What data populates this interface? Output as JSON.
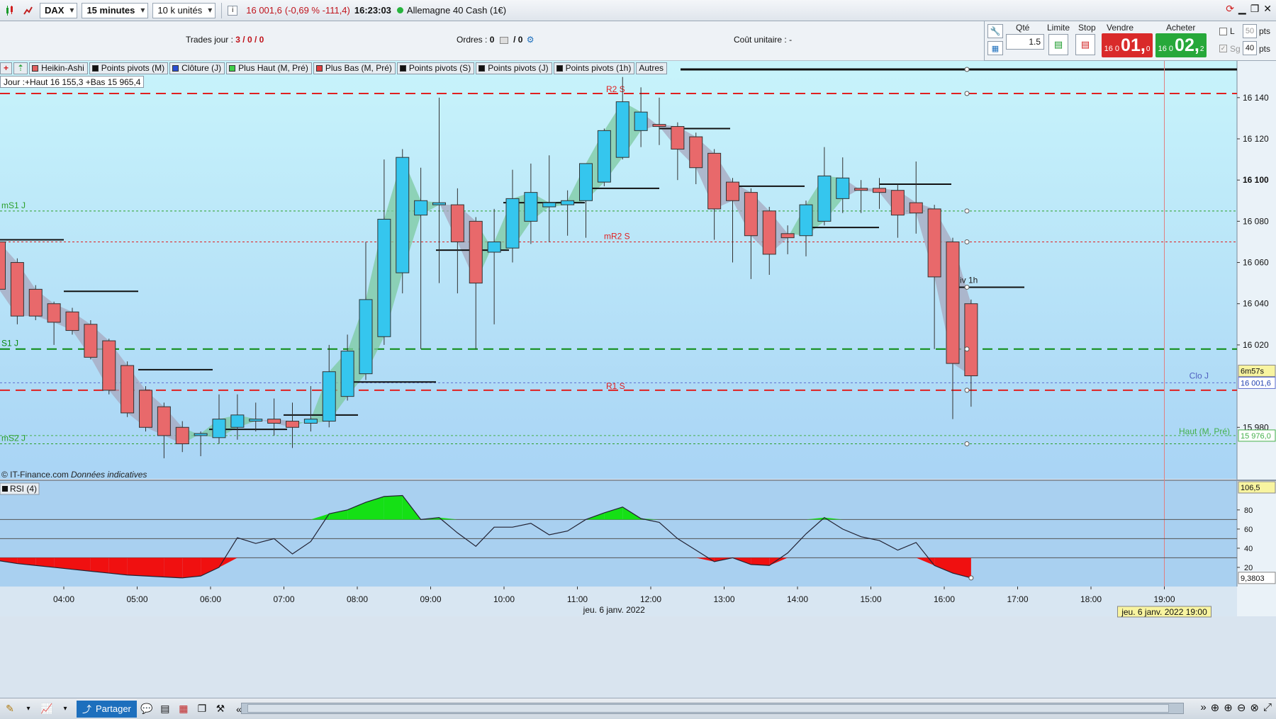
{
  "toolbar": {
    "instrument": "DAX",
    "timeframe": "15 minutes",
    "units": "10 k unités",
    "info_icon": "i",
    "price": "16 001,6",
    "change": "(-0,69 % -111,4)",
    "time": "16:23:03",
    "market": "Allemagne 40 Cash (1€)"
  },
  "infobar": {
    "trades_label": "Trades jour :",
    "trades_value": "3 / 0 / 0",
    "orders_label": "Ordres :",
    "orders_value_a": "0",
    "orders_value_b": "/ 0",
    "cost_label": "Coût unitaire :",
    "cost_value": "-"
  },
  "order_panel": {
    "qty_label": "Qté",
    "qty_value": "1.5",
    "limit_label": "Limite",
    "stop_label": "Stop",
    "sell_label": "Vendre",
    "buy_label": "Acheter",
    "sell_prefix": "16 0",
    "sell_big": "01,",
    "sell_sup": "0",
    "buy_prefix": "16 0",
    "buy_big": "02,",
    "buy_sup": "2",
    "l_label": "L",
    "sg_label": "Sg",
    "pts1_value": "50",
    "pts2_value": "40",
    "pts_label": "pts",
    "sell_color": "#d92a2a",
    "buy_color": "#27a83a"
  },
  "indicator_tags": [
    {
      "label": "Heikin-Ashi",
      "color": "#e06060"
    },
    {
      "label": "Points pivots (M)",
      "color": "#111111"
    },
    {
      "label": "Clôture (J)",
      "color": "#2a4fd1"
    },
    {
      "label": "Plus Haut (M, Pré)",
      "color": "#3fcf4a"
    },
    {
      "label": "Plus Bas (M, Pré)",
      "color": "#e04040"
    },
    {
      "label": "Points pivots (S)",
      "color": "#111111"
    },
    {
      "label": "Points pivots (J)",
      "color": "#111111"
    },
    {
      "label": "Points pivots (1h)",
      "color": "#111111"
    },
    {
      "label": "Autres",
      "color": ""
    }
  ],
  "day_info": "Jour :+Haut 16 155,3 +Bas 15 965,4",
  "copyright": "© IT-Finance.com",
  "disclaimer": "Données indicatives",
  "rsi_label": "RSI (4)",
  "date_label": "jeu. 6 janv. 2022",
  "cursor_date": "jeu. 6 janv. 2022 19:00",
  "level_labels": {
    "r2s": "R2 S",
    "ms1j": "mS1 J",
    "mr2s": "mR2 S",
    "s1j": "S1 J",
    "r1s": "R1 S",
    "ms2j": "mS2 J",
    "piv1h": "Piv 1h",
    "cloj": "Clo J",
    "hautm": "Haut (M, Pré)",
    "countdown": "6m57s",
    "last_price": "16 001,6",
    "haut_price": "15 976,0",
    "rsi_top": "106,5",
    "rsi_value": "9,3803"
  },
  "bottom": {
    "share_label": "Partager"
  },
  "chart_data": {
    "type": "candlestick",
    "instrument": "DAX",
    "timeframe": "15 minutes",
    "y_ticks": [
      "16 140",
      "16 120",
      "16 100",
      "16 080",
      "16 060",
      "16 040",
      "16 020",
      "15 980"
    ],
    "y_tick_values": [
      16140,
      16120,
      16100,
      16080,
      16060,
      16040,
      16020,
      15980
    ],
    "ylim": [
      15955,
      16153
    ],
    "x_ticks": [
      "04:00",
      "05:00",
      "06:00",
      "07:00",
      "08:00",
      "09:00",
      "10:00",
      "11:00",
      "12:00",
      "13:00",
      "14:00",
      "15:00",
      "16:00",
      "17:00",
      "18:00",
      "19:00"
    ],
    "x_tick_hours": [
      4,
      5,
      6,
      7,
      8,
      9,
      10,
      11,
      12,
      13,
      14,
      15,
      16,
      17,
      18,
      19
    ],
    "candles": [
      {
        "t": "03:00",
        "o": 16070,
        "h": 16072,
        "l": 16040,
        "c": 16047
      },
      {
        "t": "03:15",
        "o": 16060,
        "h": 16062,
        "l": 16030,
        "c": 16034
      },
      {
        "t": "03:30",
        "o": 16047,
        "h": 16049,
        "l": 16032,
        "c": 16034
      },
      {
        "t": "03:45",
        "o": 16040,
        "h": 16041,
        "l": 16020,
        "c": 16031
      },
      {
        "t": "04:00",
        "o": 16036,
        "h": 16038,
        "l": 16025,
        "c": 16027
      },
      {
        "t": "04:15",
        "o": 16030,
        "h": 16032,
        "l": 16013,
        "c": 16014
      },
      {
        "t": "04:30",
        "o": 16022,
        "h": 16023,
        "l": 15996,
        "c": 15998
      },
      {
        "t": "04:45",
        "o": 16010,
        "h": 16012,
        "l": 15985,
        "c": 15987
      },
      {
        "t": "05:00",
        "o": 15998,
        "h": 16000,
        "l": 15978,
        "c": 15980
      },
      {
        "t": "05:15",
        "o": 15990,
        "h": 15992,
        "l": 15965,
        "c": 15976
      },
      {
        "t": "05:30",
        "o": 15980,
        "h": 15983,
        "l": 15968,
        "c": 15972
      },
      {
        "t": "05:45",
        "o": 15976,
        "h": 15978,
        "l": 15966,
        "c": 15977
      },
      {
        "t": "06:00",
        "o": 15975,
        "h": 15996,
        "l": 15972,
        "c": 15984
      },
      {
        "t": "06:15",
        "o": 15980,
        "h": 15996,
        "l": 15974,
        "c": 15986
      },
      {
        "t": "06:30",
        "o": 15983,
        "h": 15992,
        "l": 15978,
        "c": 15984
      },
      {
        "t": "06:45",
        "o": 15984,
        "h": 15994,
        "l": 15976,
        "c": 15982
      },
      {
        "t": "07:00",
        "o": 15983,
        "h": 15992,
        "l": 15970,
        "c": 15980
      },
      {
        "t": "07:15",
        "o": 15982,
        "h": 16000,
        "l": 15978,
        "c": 15984
      },
      {
        "t": "07:30",
        "o": 15983,
        "h": 16020,
        "l": 15980,
        "c": 16007
      },
      {
        "t": "07:45",
        "o": 15995,
        "h": 16025,
        "l": 15993,
        "c": 16017
      },
      {
        "t": "08:00",
        "o": 16006,
        "h": 16070,
        "l": 16003,
        "c": 16042
      },
      {
        "t": "08:15",
        "o": 16024,
        "h": 16110,
        "l": 16020,
        "c": 16081
      },
      {
        "t": "08:30",
        "o": 16055,
        "h": 16115,
        "l": 16045,
        "c": 16111
      },
      {
        "t": "08:45",
        "o": 16083,
        "h": 16106,
        "l": 16018,
        "c": 16090
      },
      {
        "t": "09:00",
        "o": 16088,
        "h": 16140,
        "l": 16050,
        "c": 16089
      },
      {
        "t": "09:15",
        "o": 16088,
        "h": 16096,
        "l": 16045,
        "c": 16070
      },
      {
        "t": "09:30",
        "o": 16080,
        "h": 16082,
        "l": 16018,
        "c": 16050
      },
      {
        "t": "09:45",
        "o": 16065,
        "h": 16086,
        "l": 16030,
        "c": 16070
      },
      {
        "t": "10:00",
        "o": 16067,
        "h": 16105,
        "l": 16060,
        "c": 16091
      },
      {
        "t": "10:15",
        "o": 16080,
        "h": 16108,
        "l": 16069,
        "c": 16094
      },
      {
        "t": "10:30",
        "o": 16087,
        "h": 16112,
        "l": 16070,
        "c": 16089
      },
      {
        "t": "10:45",
        "o": 16088,
        "h": 16095,
        "l": 16073,
        "c": 16090
      },
      {
        "t": "11:00",
        "o": 16090,
        "h": 16107,
        "l": 16072,
        "c": 16108
      },
      {
        "t": "11:15",
        "o": 16099,
        "h": 16125,
        "l": 16097,
        "c": 16124
      },
      {
        "t": "11:30",
        "o": 16111,
        "h": 16150,
        "l": 16110,
        "c": 16138
      },
      {
        "t": "11:45",
        "o": 16124,
        "h": 16145,
        "l": 16116,
        "c": 16133
      },
      {
        "t": "12:00",
        "o": 16127,
        "h": 16140,
        "l": 16117,
        "c": 16126
      },
      {
        "t": "12:15",
        "o": 16126,
        "h": 16128,
        "l": 16100,
        "c": 16115
      },
      {
        "t": "12:30",
        "o": 16121,
        "h": 16123,
        "l": 16098,
        "c": 16106
      },
      {
        "t": "12:45",
        "o": 16113,
        "h": 16115,
        "l": 16071,
        "c": 16086
      },
      {
        "t": "13:00",
        "o": 16099,
        "h": 16101,
        "l": 16060,
        "c": 16090
      },
      {
        "t": "13:15",
        "o": 16094,
        "h": 16096,
        "l": 16052,
        "c": 16073
      },
      {
        "t": "13:30",
        "o": 16085,
        "h": 16087,
        "l": 16054,
        "c": 16064
      },
      {
        "t": "13:45",
        "o": 16074,
        "h": 16078,
        "l": 16064,
        "c": 16072
      },
      {
        "t": "14:00",
        "o": 16073,
        "h": 16090,
        "l": 16063,
        "c": 16088
      },
      {
        "t": "14:15",
        "o": 16080,
        "h": 16116,
        "l": 16078,
        "c": 16102
      },
      {
        "t": "14:30",
        "o": 16091,
        "h": 16111,
        "l": 16084,
        "c": 16101
      },
      {
        "t": "14:45",
        "o": 16096,
        "h": 16100,
        "l": 16084,
        "c": 16095
      },
      {
        "t": "15:00",
        "o": 16096,
        "h": 16101,
        "l": 16086,
        "c": 16094
      },
      {
        "t": "15:15",
        "o": 16095,
        "h": 16098,
        "l": 16072,
        "c": 16083
      },
      {
        "t": "15:30",
        "o": 16089,
        "h": 16109,
        "l": 16074,
        "c": 16084
      },
      {
        "t": "15:45",
        "o": 16086,
        "h": 16088,
        "l": 16018,
        "c": 16053
      },
      {
        "t": "16:00",
        "o": 16070,
        "h": 16072,
        "l": 15984,
        "c": 16011
      },
      {
        "t": "16:15",
        "o": 16040,
        "h": 16042,
        "l": 15990,
        "c": 16005
      }
    ],
    "levels": [
      {
        "name": "R2 S",
        "value": 16142,
        "style": "dashed",
        "color": "#e02020"
      },
      {
        "name": "mS1 J",
        "value": 16085,
        "style": "dotted",
        "color": "#2ca02c"
      },
      {
        "name": "mR2 S",
        "value": 16070,
        "style": "dotted",
        "color": "#e02020"
      },
      {
        "name": "S1 J",
        "value": 16018,
        "style": "dashed",
        "color": "#0a8a10"
      },
      {
        "name": "R1 S",
        "value": 15998,
        "style": "dashed",
        "color": "#e02020"
      },
      {
        "name": "Haut (M, Pré)",
        "value": 15976,
        "style": "dotted",
        "color": "#44b04a"
      },
      {
        "name": "mS2 J",
        "value": 15972,
        "style": "dotted",
        "color": "#2ca02c"
      },
      {
        "name": "Clo J",
        "value": 16001.6,
        "style": "dotted",
        "color": "#6070d0"
      }
    ],
    "rsi": {
      "name": "RSI (4)",
      "levels": [
        30,
        50,
        70
      ],
      "y_ticks": [
        20,
        40,
        60,
        80
      ],
      "ylim": [
        0,
        106.5
      ],
      "last": 9.3803,
      "values": [
        27,
        24,
        22,
        20,
        18,
        16,
        14,
        12,
        11,
        10,
        9,
        11,
        20,
        51,
        45,
        50,
        34,
        47,
        76,
        80,
        88,
        94,
        95,
        70,
        72,
        56,
        42,
        62,
        62,
        66,
        54,
        58,
        70,
        77,
        83,
        71,
        67,
        50,
        38,
        26,
        30,
        23,
        22,
        35,
        55,
        72,
        60,
        52,
        48,
        38,
        46,
        22,
        14,
        9
      ]
    }
  }
}
